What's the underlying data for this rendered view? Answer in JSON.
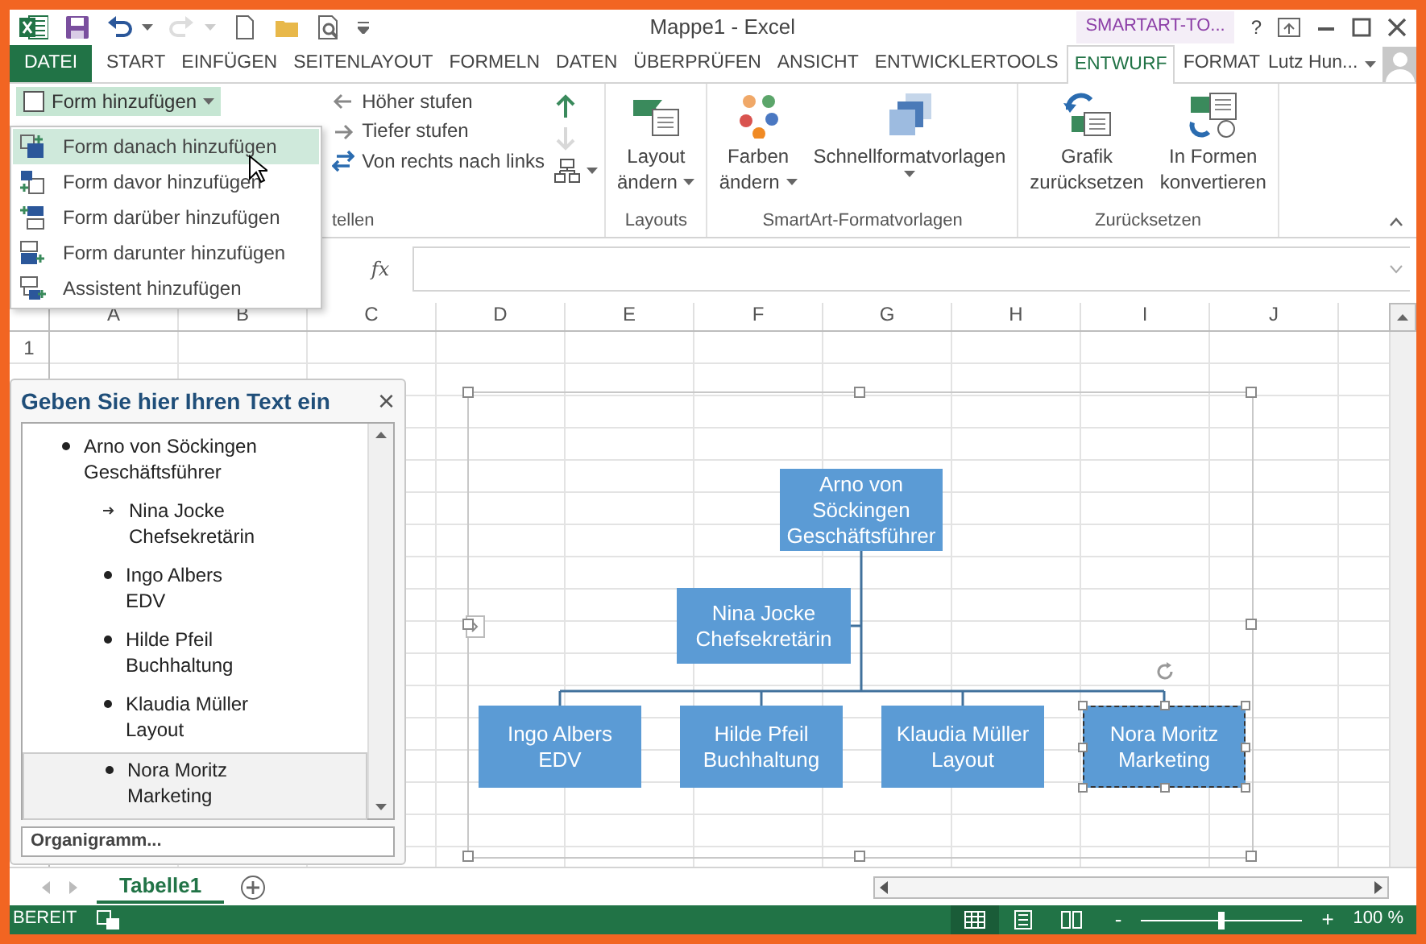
{
  "window": {
    "title": "Mappe1 - Excel",
    "context_label": "SMARTART-TO...",
    "help": "?"
  },
  "quick_access": [
    {
      "kind": "save",
      "disabled": false
    },
    {
      "kind": "undo",
      "disabled": false
    },
    {
      "kind": "redo",
      "disabled": true
    },
    {
      "kind": "new",
      "disabled": false
    },
    {
      "kind": "open",
      "disabled": false
    },
    {
      "kind": "preview",
      "disabled": false
    }
  ],
  "ribbon_tabs": [
    {
      "label": "DATEI",
      "kind": "file",
      "selected": false
    },
    {
      "label": "START",
      "kind": "tab",
      "selected": false
    },
    {
      "label": "EINFÜGEN",
      "kind": "tab",
      "selected": false
    },
    {
      "label": "SEITENLAYOUT",
      "kind": "tab",
      "selected": false
    },
    {
      "label": "FORMELN",
      "kind": "tab",
      "selected": false
    },
    {
      "label": "DATEN",
      "kind": "tab",
      "selected": false
    },
    {
      "label": "ÜBERPRÜFEN",
      "kind": "tab",
      "selected": false
    },
    {
      "label": "ANSICHT",
      "kind": "tab",
      "selected": false
    },
    {
      "label": "ENTWICKLERTOOLS",
      "kind": "tab",
      "selected": false
    },
    {
      "label": "ENTWURF",
      "kind": "tab",
      "selected": true
    },
    {
      "label": "FORMAT",
      "kind": "tab",
      "selected": false
    }
  ],
  "user": {
    "name": "Lutz Hun..."
  },
  "ribbon": {
    "add_shape_button": {
      "label": "Form hinzufügen",
      "pressed": true
    },
    "level_buttons": [
      {
        "label": "Höher stufen",
        "kind": "promote"
      },
      {
        "label": "Tiefer stufen",
        "kind": "demote"
      },
      {
        "label": "Von rechts nach links",
        "kind": "rtl"
      }
    ],
    "move_buttons": [
      {
        "kind": "up",
        "disabled": false
      },
      {
        "kind": "down",
        "disabled": true
      },
      {
        "kind": "layout",
        "disabled": false
      }
    ],
    "create_group_label": "tellen",
    "groups": [
      {
        "label": "Layouts",
        "buttons": [
          {
            "kind": "layout",
            "lines": [
              "Layout",
              "ändern"
            ],
            "dropdown": true
          }
        ]
      },
      {
        "label": "SmartArt-Formatvorlagen",
        "buttons": [
          {
            "kind": "colors",
            "lines": [
              "Farben",
              "ändern"
            ],
            "dropdown": true
          },
          {
            "kind": "styles",
            "lines": [
              "Schnellformatvorlagen"
            ],
            "dropdown": true
          }
        ]
      },
      {
        "label": "Zurücksetzen",
        "buttons": [
          {
            "kind": "reset",
            "lines": [
              "Grafik",
              "zurücksetzen"
            ],
            "dropdown": false
          },
          {
            "kind": "convert",
            "lines": [
              "In Formen",
              "konvertieren"
            ],
            "dropdown": false
          }
        ]
      }
    ]
  },
  "add_shape_menu": {
    "items": [
      {
        "label": "Form danach hinzufügen",
        "kind": "after",
        "selected": true
      },
      {
        "label": "Form davor hinzufügen",
        "kind": "before",
        "selected": false
      },
      {
        "label": "Form darüber hinzufügen",
        "kind": "above",
        "selected": false
      },
      {
        "label": "Form darunter hinzufügen",
        "kind": "below",
        "selected": false
      },
      {
        "label": "Assistent hinzufügen",
        "kind": "assistant",
        "selected": false
      }
    ]
  },
  "formula_bar": {
    "function_label": "fx"
  },
  "sheet": {
    "columns": [
      "A",
      "B",
      "C",
      "D",
      "E",
      "F",
      "G",
      "H",
      "I",
      "J"
    ],
    "rows": [
      "1"
    ]
  },
  "text_pane": {
    "title": "Geben Sie hier Ihren Text ein",
    "close": "×",
    "footer": "Organigramm...",
    "items": [
      {
        "name": "Arno von Söckingen",
        "role": "Geschäftsführer",
        "kind": "bullet",
        "selected": false,
        "children": [
          {
            "name": "Nina Jocke",
            "role": "Chefsekretärin",
            "kind": "assistant",
            "selected": false
          },
          {
            "name": "Ingo Albers",
            "role": "EDV",
            "kind": "bullet",
            "selected": false
          },
          {
            "name": "Hilde Pfeil",
            "role": "Buchhaltung",
            "kind": "bullet",
            "selected": false
          },
          {
            "name": "Klaudia Müller",
            "role": "Layout",
            "kind": "bullet",
            "selected": false
          },
          {
            "name": "Nora Moritz",
            "role": "Marketing",
            "kind": "bullet",
            "selected": true
          }
        ]
      }
    ]
  },
  "org_chart": {
    "root": {
      "name": "Arno von Söckingen",
      "role": "Geschäftsführer",
      "selected": false,
      "children": [
        {
          "name": "Nina Jocke",
          "role": "Chefsekretärin",
          "kind": "assistant",
          "selected": false
        },
        {
          "name": "Ingo Albers",
          "role": "EDV",
          "kind": "staff",
          "selected": false
        },
        {
          "name": "Hilde Pfeil",
          "role": "Buchhaltung",
          "kind": "staff",
          "selected": false
        },
        {
          "name": "Klaudia Müller",
          "role": "Layout",
          "kind": "staff",
          "selected": false
        },
        {
          "name": "Nora Moritz",
          "role": "Marketing",
          "kind": "staff",
          "selected": true
        }
      ]
    }
  },
  "sheet_tabs": [
    {
      "label": "Tabelle1",
      "selected": true
    }
  ],
  "status_bar": {
    "mode": "BEREIT",
    "views": [
      {
        "kind": "normal",
        "selected": true
      },
      {
        "kind": "page_layout",
        "selected": false
      },
      {
        "kind": "page_break",
        "selected": false
      }
    ],
    "zoom_out": "-",
    "zoom_in": "+",
    "zoom_slider": {
      "level": 0.5
    },
    "zoom": "100 %"
  }
}
